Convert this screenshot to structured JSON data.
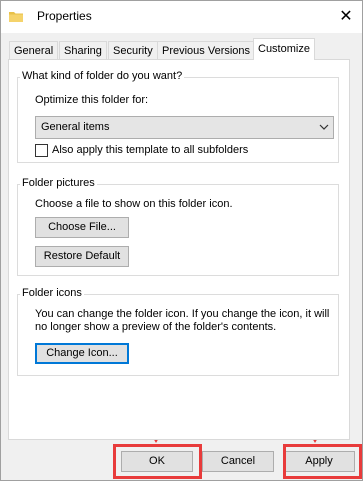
{
  "window": {
    "title": "Properties",
    "close_glyph": "✕",
    "icon": "folder-icon"
  },
  "tabs": [
    {
      "label": "General"
    },
    {
      "label": "Sharing"
    },
    {
      "label": "Security"
    },
    {
      "label": "Previous Versions"
    },
    {
      "label": "Customize",
      "active": true
    }
  ],
  "folder_type": {
    "heading": "What kind of folder do you want?",
    "optimize_label": "Optimize this folder for:",
    "selected_option": "General items",
    "apply_subfolders_label": "Also apply this template to all subfolders",
    "apply_subfolders_checked": false
  },
  "folder_pictures": {
    "heading": "Folder pictures",
    "description": "Choose a file to show on this folder icon.",
    "choose_file_label": "Choose File...",
    "restore_default_label": "Restore Default"
  },
  "folder_icons": {
    "heading": "Folder icons",
    "description_line1": "You can change the folder icon. If you change the icon, it will",
    "description_line2": "no longer show a preview of the folder's contents.",
    "change_icon_label": "Change Icon..."
  },
  "footer": {
    "ok_label": "OK",
    "cancel_label": "Cancel",
    "apply_label": "Apply"
  },
  "annotation": {
    "color": "#e83b3b"
  }
}
